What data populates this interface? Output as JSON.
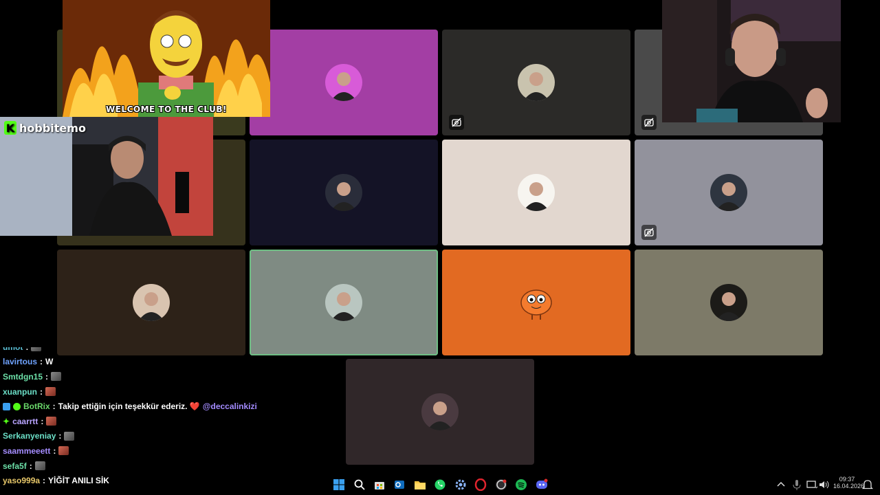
{
  "participants": [
    {
      "id": "p1",
      "bg": "#3a3a1e",
      "muted": false
    },
    {
      "id": "p2",
      "bg": "#a33ea4",
      "muted": false
    },
    {
      "id": "p3",
      "bg": "#2b2a28",
      "muted": true
    },
    {
      "id": "p4",
      "bg": "#4a4a4a",
      "muted": true
    },
    {
      "id": "p5",
      "bg": "#36321c",
      "muted": false
    },
    {
      "id": "p6",
      "bg": "#141326",
      "muted": false
    },
    {
      "id": "p7",
      "bg": "#e2d7cf",
      "muted": false
    },
    {
      "id": "p8",
      "bg": "#92929c",
      "muted": true
    },
    {
      "id": "p9",
      "bg": "#2d2218",
      "muted": false
    },
    {
      "id": "p10",
      "bg": "#7f8b83",
      "muted": false,
      "speaking": true
    },
    {
      "id": "p11",
      "bg": "#e26a22",
      "muted": false
    },
    {
      "id": "p12",
      "bg": "#7d7a68",
      "muted": false
    },
    {
      "id": "p13",
      "bg": "#302729",
      "muted": false
    }
  ],
  "overlays": {
    "gif_caption": "WELCOME TO THE CLUB!",
    "streamer_name": "hobbitemo"
  },
  "chat": {
    "messages": [
      {
        "user": "umot",
        "color": "#5bc0d6",
        "text": "",
        "emote": "a"
      },
      {
        "user": "lavirtous",
        "color": "#6fa3ff",
        "text": "W",
        "emote": ""
      },
      {
        "user": "Smtdgn15",
        "color": "#6ce0a8",
        "text": "",
        "emote": "a"
      },
      {
        "user": "xuanpun",
        "color": "#6ce0c8",
        "text": "",
        "emote": "b"
      },
      {
        "user": "BotRix",
        "color": "#6bd96b",
        "text": "Takip ettiğin için teşekkür ederiz. ❤️",
        "mention": "@deccalinkizi",
        "emote": "",
        "bot": true
      },
      {
        "user": "caarrtt",
        "color": "#b9a4ff",
        "text": "",
        "emote": "b",
        "star": true
      },
      {
        "user": "Serkanyeniay",
        "color": "#6ce0c8",
        "text": "",
        "emote": "a"
      },
      {
        "user": "saammeeett",
        "color": "#a48cff",
        "text": "",
        "emote": "b"
      },
      {
        "user": "sefa5f",
        "color": "#6ce0a8",
        "text": "",
        "emote": "a"
      },
      {
        "user": "yaso999a",
        "color": "#e8c86a",
        "text": "YİĞİT ANILI SİK",
        "emote": ""
      }
    ]
  },
  "taskbar": {
    "icons": [
      "windows-start-icon",
      "search-icon",
      "store-icon",
      "outlook-icon",
      "file-explorer-icon",
      "whatsapp-icon",
      "settings-icon",
      "opera-icon",
      "obs-icon",
      "spotify-icon",
      "discord-icon"
    ],
    "time": "09:37",
    "date": "16.04.2026"
  },
  "colors": {
    "accent": "#53fc18",
    "speaking": "#6fbf85"
  }
}
